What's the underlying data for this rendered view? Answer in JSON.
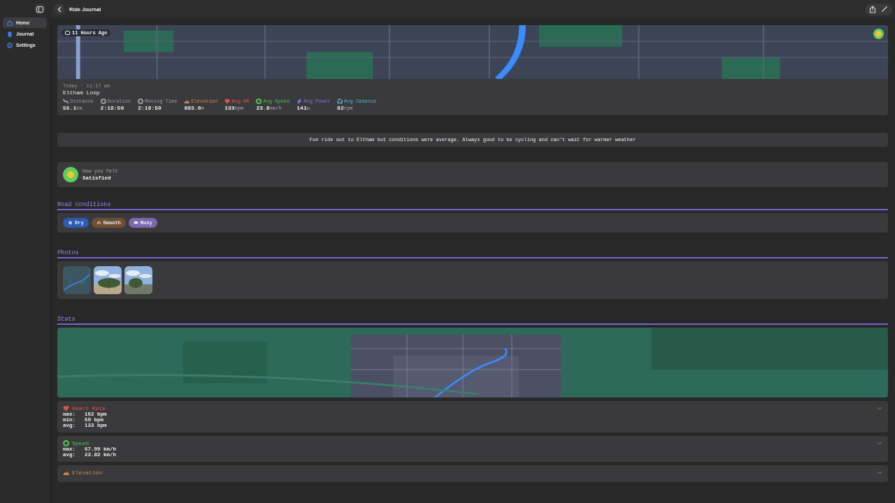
{
  "sidebar": {
    "items": [
      {
        "label": "Home",
        "kind": "home",
        "selected": true
      },
      {
        "label": "Journal",
        "kind": "journal",
        "selected": false
      },
      {
        "label": "Settings",
        "kind": "settings",
        "selected": false
      }
    ]
  },
  "toolbar": {
    "title": "Ride Journal"
  },
  "ride": {
    "time_badge": "11 Hours Ago",
    "date": "Today · 11:17 am",
    "name": "Eltham Loop",
    "metrics": [
      {
        "kind": "distance",
        "label": "Distance",
        "value": "56.1",
        "unit": "km",
        "color": "#9a9a9e"
      },
      {
        "kind": "duration",
        "label": "Duration",
        "value": "2:18:50",
        "color": "#9a9a9e"
      },
      {
        "kind": "moving",
        "label": "Moving Time",
        "value": "2:18:50",
        "color": "#9a9a9e"
      },
      {
        "kind": "elevation",
        "label": "Elevation",
        "value": "883.0",
        "unit": "m",
        "color": "#c98a4b"
      },
      {
        "kind": "heart",
        "label": "Avg HR",
        "value": "133",
        "unit": "bpm",
        "color": "#e0524a"
      },
      {
        "kind": "speed",
        "label": "Avg Speed",
        "value": "23.8",
        "unit": "km/h",
        "color": "#4cc24c"
      },
      {
        "kind": "power",
        "label": "Avg Power",
        "value": "141",
        "unit": "w",
        "color": "#7f73e6"
      },
      {
        "kind": "cadence",
        "label": "Avg Cadence",
        "value": "82",
        "unit": "rpm",
        "color": "#4ab8d8"
      }
    ]
  },
  "note": "Fun ride out to Eltham but conditions were average. Always good to be cycling and can't wait for warmer weather",
  "feeling": {
    "label": "How you felt",
    "value": "Satisfied"
  },
  "road_conditions": {
    "title": "Road conditions",
    "tags": [
      {
        "kind": "dry",
        "label": "Dry",
        "color": "#2a5bb5"
      },
      {
        "kind": "smooth",
        "label": "Smooth",
        "color": "#6e4f32"
      },
      {
        "kind": "busy",
        "label": "Busy",
        "color": "#7a68b0"
      }
    ]
  },
  "photos": {
    "title": "Photos"
  },
  "stats": {
    "title": "Stats",
    "sections": [
      {
        "kind": "heart",
        "title": "Heart Rate",
        "color": "#e0524a",
        "rows": [
          {
            "label": "max:",
            "value": "162 bpm"
          },
          {
            "label": "min:",
            "value": "59 bpm"
          },
          {
            "label": "avg:",
            "value": "133 bpm"
          }
        ]
      },
      {
        "kind": "speed",
        "title": "Speed",
        "color": "#4cc24c",
        "rows": [
          {
            "label": "max:",
            "value": "67.99 km/h"
          },
          {
            "label": "avg:",
            "value": "23.82 km/h"
          }
        ]
      },
      {
        "kind": "elevation",
        "title": "Elevation",
        "color": "#c98a4b"
      }
    ]
  }
}
